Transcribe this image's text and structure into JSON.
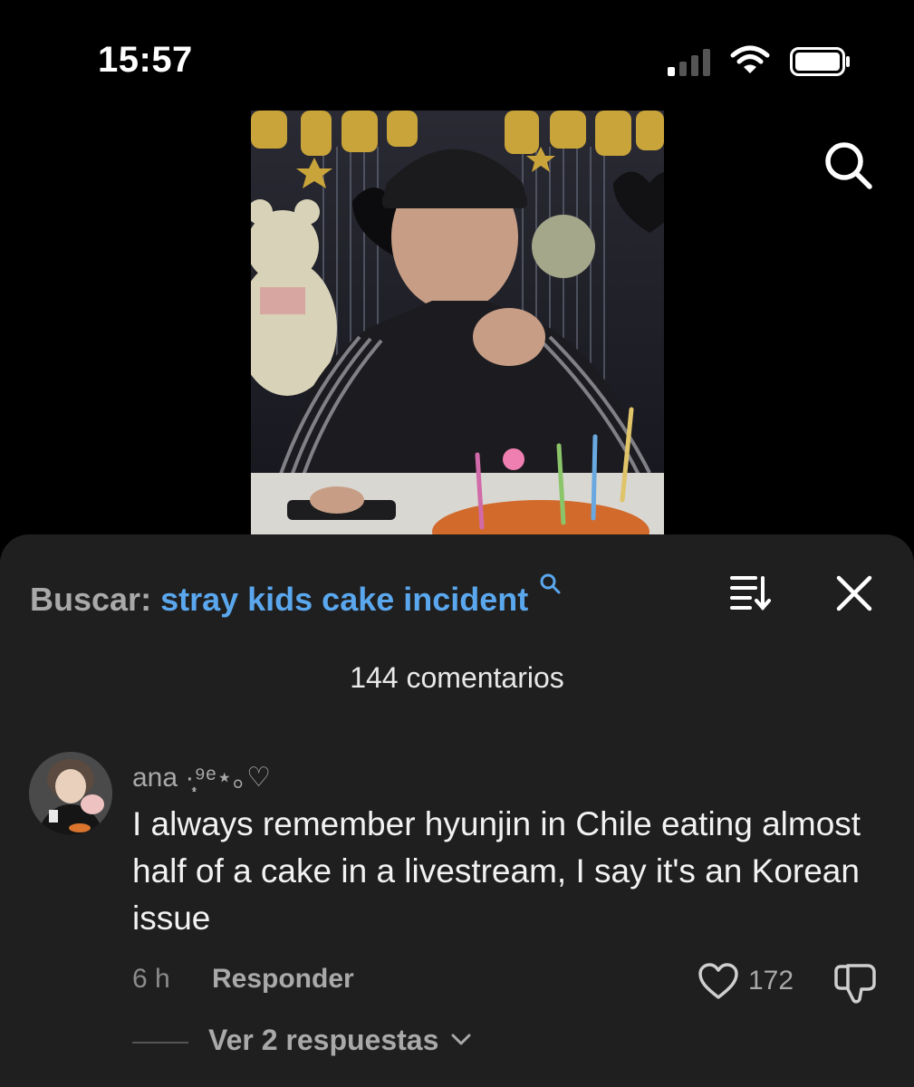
{
  "status_bar": {
    "time": "15:57"
  },
  "search": {
    "prefix": "Buscar:",
    "query": "stray kids cake incident"
  },
  "comments": {
    "count_label": "144 comentarios",
    "items": [
      {
        "username": "ana ·̩͙⁹ᵉ⋆｡♡",
        "text": "I always remember hyunjin in Chile eating almost half of a cake in a livestream, I say it's an Korean issue",
        "time_ago": "6 h",
        "reply_label": "Responder",
        "like_count": "172",
        "replies_label": "Ver 2 respuestas"
      }
    ]
  },
  "icons": {
    "search": "search-icon",
    "sort": "sort-icon",
    "close": "close-icon",
    "heart": "heart-icon",
    "dislike": "dislike-icon",
    "chevron": "chevron-down-icon"
  },
  "colors": {
    "accent": "#5aa7ee",
    "sheet_bg": "#1f1f1f",
    "muted_text": "#a9a9a9"
  }
}
